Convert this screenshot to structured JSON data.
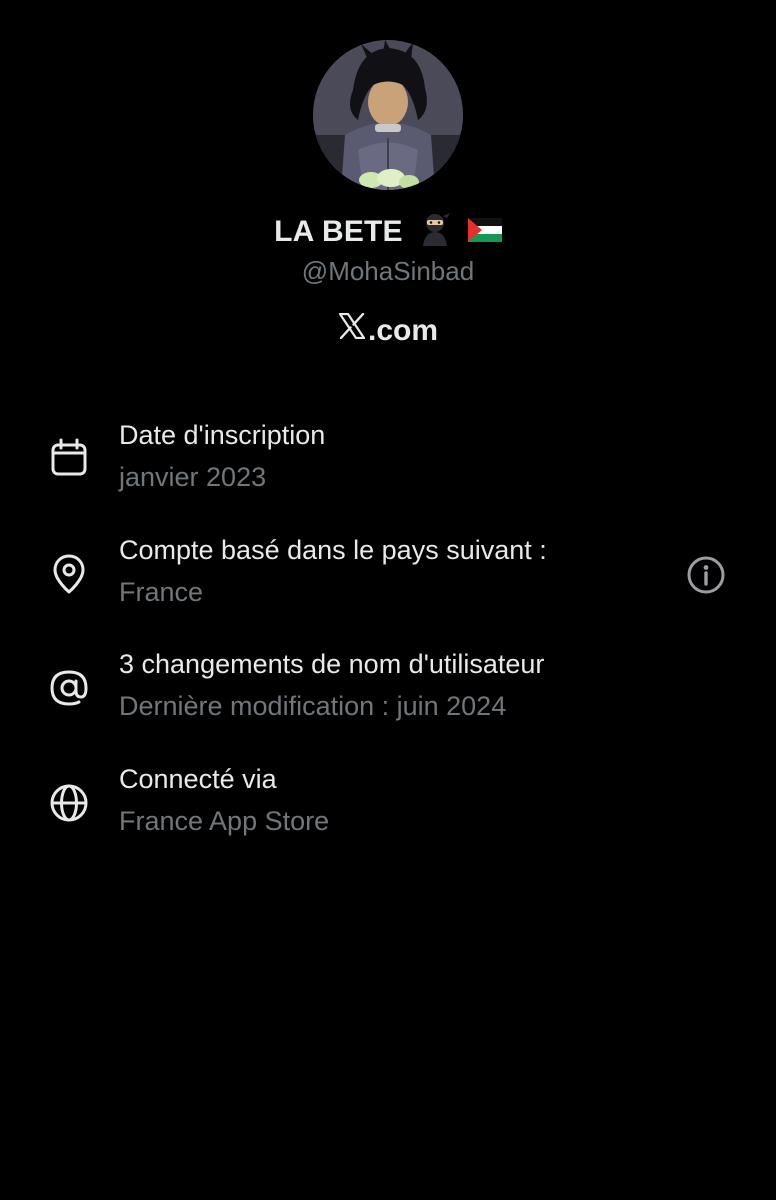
{
  "profile": {
    "display_name": "LA BETE",
    "handle": "@MohaSinbad",
    "site": ".com",
    "site_logo": "x-logo-icon",
    "name_emojis": [
      "ninja-emoji",
      "palestine-flag-emoji"
    ]
  },
  "about": {
    "rows": [
      {
        "icon": "calendar-icon",
        "title": "Date d'inscription",
        "value": "janvier 2023"
      },
      {
        "icon": "location-pin-icon",
        "title": "Compte basé dans le pays suivant :",
        "value": "France"
      },
      {
        "icon": "at-sign-icon",
        "title": "3 changements de nom d'utilisateur",
        "value": "Dernière modification : juin 2024"
      },
      {
        "icon": "globe-icon",
        "title": "Connecté via",
        "value": "France App Store"
      }
    ]
  },
  "colors": {
    "background": "#000000",
    "primary_text": "#e7e9ea",
    "secondary_text": "#71767b"
  }
}
